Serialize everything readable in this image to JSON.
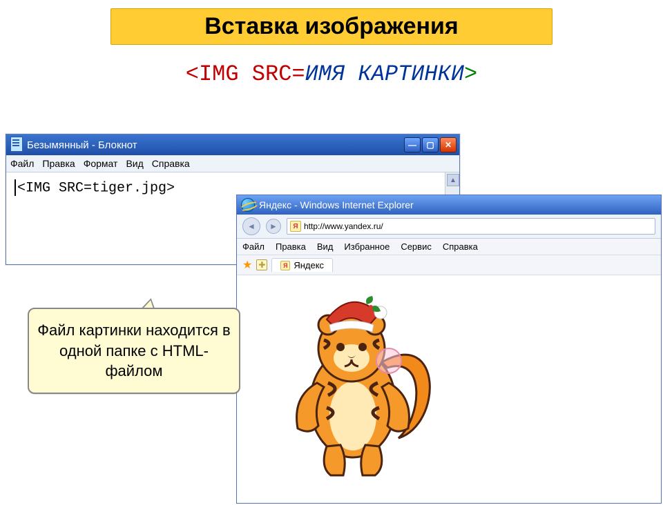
{
  "title": "Вставка изображения",
  "code_line": {
    "red": "<IMG SRC=",
    "blue": "ИМЯ КАРТИНКИ",
    "green": ">"
  },
  "notepad": {
    "window_title": "Безымянный - Блокнот",
    "menu": [
      "Файл",
      "Правка",
      "Формат",
      "Вид",
      "Справка"
    ],
    "content": "<IMG SRC=tiger.jpg>"
  },
  "ie": {
    "window_title": "Яндекс - Windows Internet Explorer",
    "url": "http://www.yandex.ru/",
    "menu": [
      "Файл",
      "Правка",
      "Вид",
      "Избранное",
      "Сервис",
      "Справка"
    ],
    "tab_label": "Яндекс",
    "favicon_letter": "Я"
  },
  "callout": "Файл картинки находится в одной папке с HTML-файлом"
}
